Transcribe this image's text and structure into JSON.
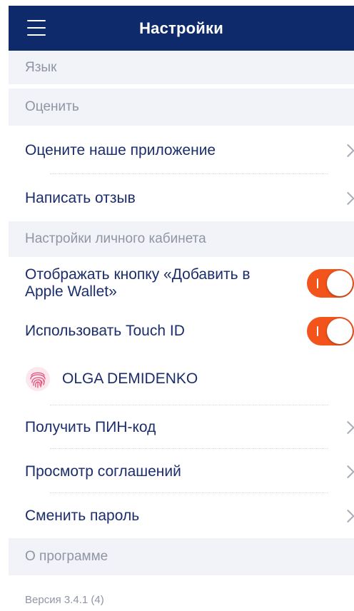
{
  "header": {
    "title": "Настройки"
  },
  "sections": {
    "language": "Язык",
    "rate": "Оценить",
    "account": "Настройки личного кабинета",
    "about": "О программе"
  },
  "rows": {
    "rate_app": "Оцените наше приложение",
    "write_review": "Написать отзыв",
    "apple_wallet_line1": "Отображать кнопку «Добавить в",
    "apple_wallet_line2": "Apple Wallet»",
    "touch_id": "Использовать Touch ID",
    "user_name": "OLGA DEMIDENKO",
    "get_pin": "Получить ПИН-код",
    "view_agreements": "Просмотр соглашений",
    "change_password": "Сменить пароль"
  },
  "toggles": {
    "apple_wallet": true,
    "touch_id": true
  },
  "footer": {
    "version": "Версия 3.4.1 (4)"
  },
  "icons": {
    "menu": "hamburger-menu-icon",
    "chevron": "chevron-right-icon",
    "fingerprint": "fingerprint-icon"
  },
  "colors": {
    "header_bg": "#0e2a6b",
    "section_bg": "#f2f3f8",
    "accent_toggle": "#f2541b",
    "text_primary": "#1b2d6b",
    "text_secondary": "#8f95a3"
  }
}
